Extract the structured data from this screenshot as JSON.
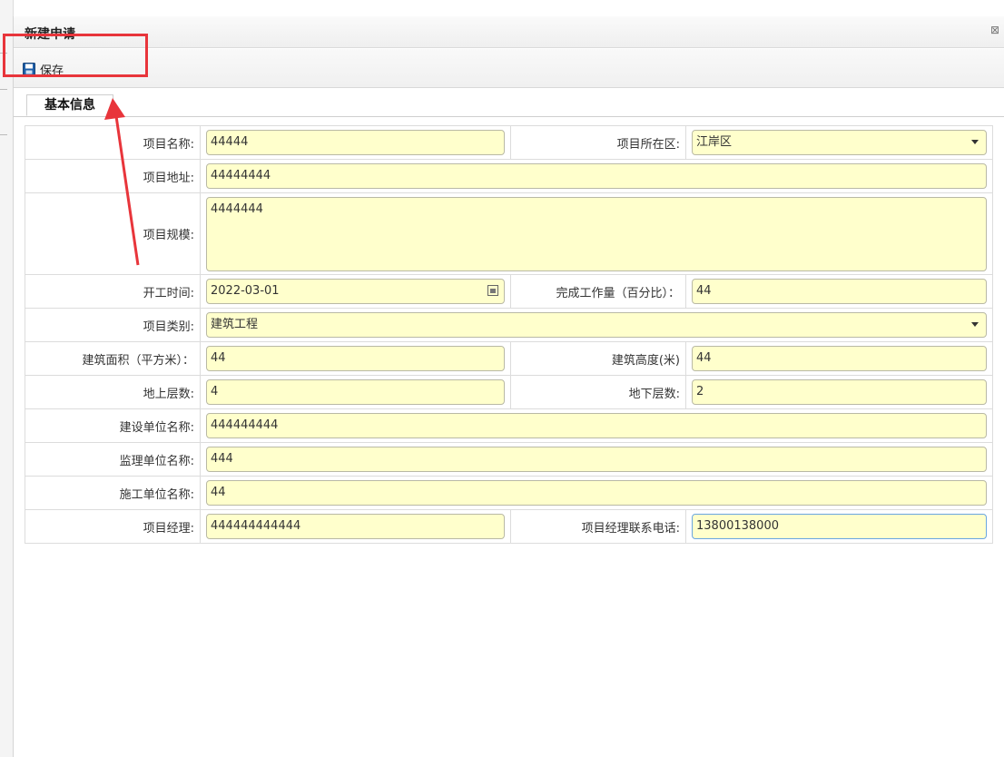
{
  "dialog": {
    "title": "新建申请"
  },
  "toolbar": {
    "save_label": "保存"
  },
  "tabs": [
    {
      "label": "基本信息"
    }
  ],
  "form": {
    "project_name": {
      "label": "项目名称:",
      "value": "44444"
    },
    "project_district": {
      "label": "项目所在区:",
      "value": "江岸区"
    },
    "project_address": {
      "label": "项目地址:",
      "value": "44444444"
    },
    "project_scale": {
      "label": "项目规模:",
      "value": "4444444"
    },
    "start_date": {
      "label": "开工时间:",
      "value": "2022-03-01"
    },
    "completion_percent": {
      "label": "完成工作量（百分比）：",
      "value": "44"
    },
    "project_category": {
      "label": "项目类别:",
      "value": "建筑工程"
    },
    "building_area": {
      "label": "建筑面积（平方米）：",
      "value": "44"
    },
    "building_height": {
      "label": "建筑高度(米)",
      "value": "44"
    },
    "floors_above": {
      "label": "地上层数:",
      "value": "4"
    },
    "floors_below": {
      "label": "地下层数:",
      "value": "2"
    },
    "construction_unit": {
      "label": "建设单位名称:",
      "value": "444444444"
    },
    "supervision_unit": {
      "label": "监理单位名称:",
      "value": "444"
    },
    "builder_unit": {
      "label": "施工单位名称:",
      "value": "44"
    },
    "project_manager": {
      "label": "项目经理:",
      "value": "444444444444"
    },
    "manager_phone": {
      "label": "项目经理联系电话:",
      "value": "13800138000"
    }
  },
  "colors": {
    "input_bg": "#ffffcc",
    "highlight": "#e8353b",
    "save_icon": "#1f5fa8"
  },
  "icons": {
    "save": "floppy-disk-icon",
    "close": "close-icon",
    "calendar": "calendar-icon",
    "dropdown": "chevron-down-icon"
  }
}
